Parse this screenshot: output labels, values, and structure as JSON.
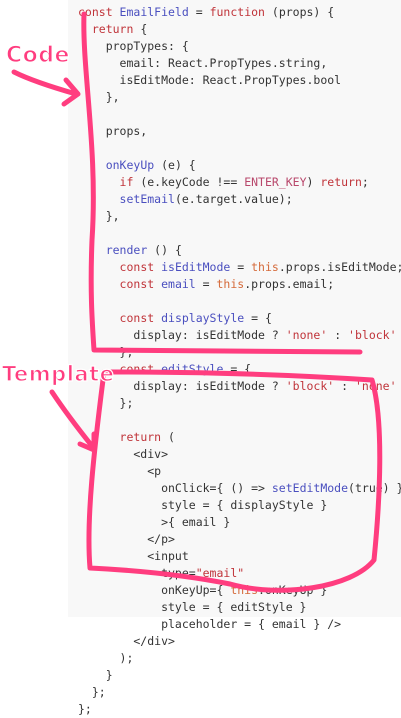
{
  "annotation_labels": {
    "code": "Code",
    "template": "Template"
  },
  "colors": {
    "annotation": "#ff3d7f",
    "panel_background": "#f8f8f8",
    "keyword": "#c0343a",
    "function_name": "#4a4fbf",
    "constant": "#b8476b",
    "string": "#c0343a",
    "this_keyword": "#d56a3a",
    "plain": "#333333"
  },
  "code_lines": [
    [
      [
        "kw",
        "const "
      ],
      [
        "fn",
        "EmailField"
      ],
      [
        "plain",
        " = "
      ],
      [
        "kw",
        "function"
      ],
      [
        "plain",
        " (props) {"
      ]
    ],
    [
      [
        "plain",
        "  "
      ],
      [
        "kw",
        "return"
      ],
      [
        "plain",
        " {"
      ]
    ],
    [
      [
        "plain",
        "    propTypes: {"
      ]
    ],
    [
      [
        "plain",
        "      email: React.PropTypes.string,"
      ]
    ],
    [
      [
        "plain",
        "      isEditMode: React.PropTypes.bool"
      ]
    ],
    [
      [
        "plain",
        "    },"
      ]
    ],
    [],
    [
      [
        "plain",
        "    props,"
      ]
    ],
    [],
    [
      [
        "plain",
        "    "
      ],
      [
        "fn",
        "onKeyUp"
      ],
      [
        "plain",
        " (e) {"
      ]
    ],
    [
      [
        "plain",
        "      "
      ],
      [
        "kw",
        "if"
      ],
      [
        "plain",
        " (e.keyCode !== "
      ],
      [
        "const",
        "ENTER_KEY"
      ],
      [
        "plain",
        ") "
      ],
      [
        "kw",
        "return"
      ],
      [
        "plain",
        ";"
      ]
    ],
    [
      [
        "plain",
        "      "
      ],
      [
        "fn",
        "setEmail"
      ],
      [
        "plain",
        "(e.target.value);"
      ]
    ],
    [
      [
        "plain",
        "    },"
      ]
    ],
    [],
    [
      [
        "plain",
        "    "
      ],
      [
        "fn",
        "render"
      ],
      [
        "plain",
        " () {"
      ]
    ],
    [
      [
        "plain",
        "      "
      ],
      [
        "kw",
        "const "
      ],
      [
        "fn",
        "isEditMode"
      ],
      [
        "plain",
        " = "
      ],
      [
        "this",
        "this"
      ],
      [
        "plain",
        ".props.isEditMode;"
      ]
    ],
    [
      [
        "plain",
        "      "
      ],
      [
        "kw",
        "const "
      ],
      [
        "fn",
        "email"
      ],
      [
        "plain",
        " = "
      ],
      [
        "this",
        "this"
      ],
      [
        "plain",
        ".props.email;"
      ]
    ],
    [],
    [
      [
        "plain",
        "      "
      ],
      [
        "kw",
        "const "
      ],
      [
        "fn",
        "displayStyle"
      ],
      [
        "plain",
        " = {"
      ]
    ],
    [
      [
        "plain",
        "        display: isEditMode ? "
      ],
      [
        "str",
        "'none'"
      ],
      [
        "plain",
        " : "
      ],
      [
        "str",
        "'block'"
      ]
    ],
    [
      [
        "plain",
        "      };"
      ]
    ],
    [
      [
        "plain",
        "      "
      ],
      [
        "kw",
        "const "
      ],
      [
        "fn",
        "editStyle"
      ],
      [
        "plain",
        " = {"
      ]
    ],
    [
      [
        "plain",
        "        display: isEditMode ? "
      ],
      [
        "str",
        "'block'"
      ],
      [
        "plain",
        " : "
      ],
      [
        "str",
        "'none'"
      ]
    ],
    [
      [
        "plain",
        "      };"
      ]
    ],
    [],
    [
      [
        "plain",
        "      "
      ],
      [
        "kw",
        "return"
      ],
      [
        "plain",
        " ("
      ]
    ],
    [
      [
        "plain",
        "        <div>"
      ]
    ],
    [
      [
        "plain",
        "          <p"
      ]
    ],
    [
      [
        "plain",
        "            onClick={ () => "
      ],
      [
        "fn",
        "setEditMode"
      ],
      [
        "plain",
        "(true) }"
      ]
    ],
    [
      [
        "plain",
        "            style = { displayStyle }"
      ]
    ],
    [
      [
        "plain",
        "            >{ email }"
      ]
    ],
    [
      [
        "plain",
        "          </p>"
      ]
    ],
    [
      [
        "plain",
        "          <input"
      ]
    ],
    [
      [
        "plain",
        "            type="
      ],
      [
        "str",
        "\"email\""
      ]
    ],
    [
      [
        "plain",
        "            onKeyUp={ "
      ],
      [
        "this",
        "this"
      ],
      [
        "plain",
        ".onKeyUp }"
      ]
    ],
    [
      [
        "plain",
        "            style = { editStyle }"
      ]
    ],
    [
      [
        "plain",
        "            placeholder = { email } />"
      ]
    ],
    [
      [
        "plain",
        "        </div>"
      ]
    ],
    [
      [
        "plain",
        "      );"
      ]
    ],
    [
      [
        "plain",
        "    }"
      ]
    ],
    [
      [
        "plain",
        "  };"
      ]
    ],
    [
      [
        "plain",
        "};"
      ]
    ]
  ]
}
